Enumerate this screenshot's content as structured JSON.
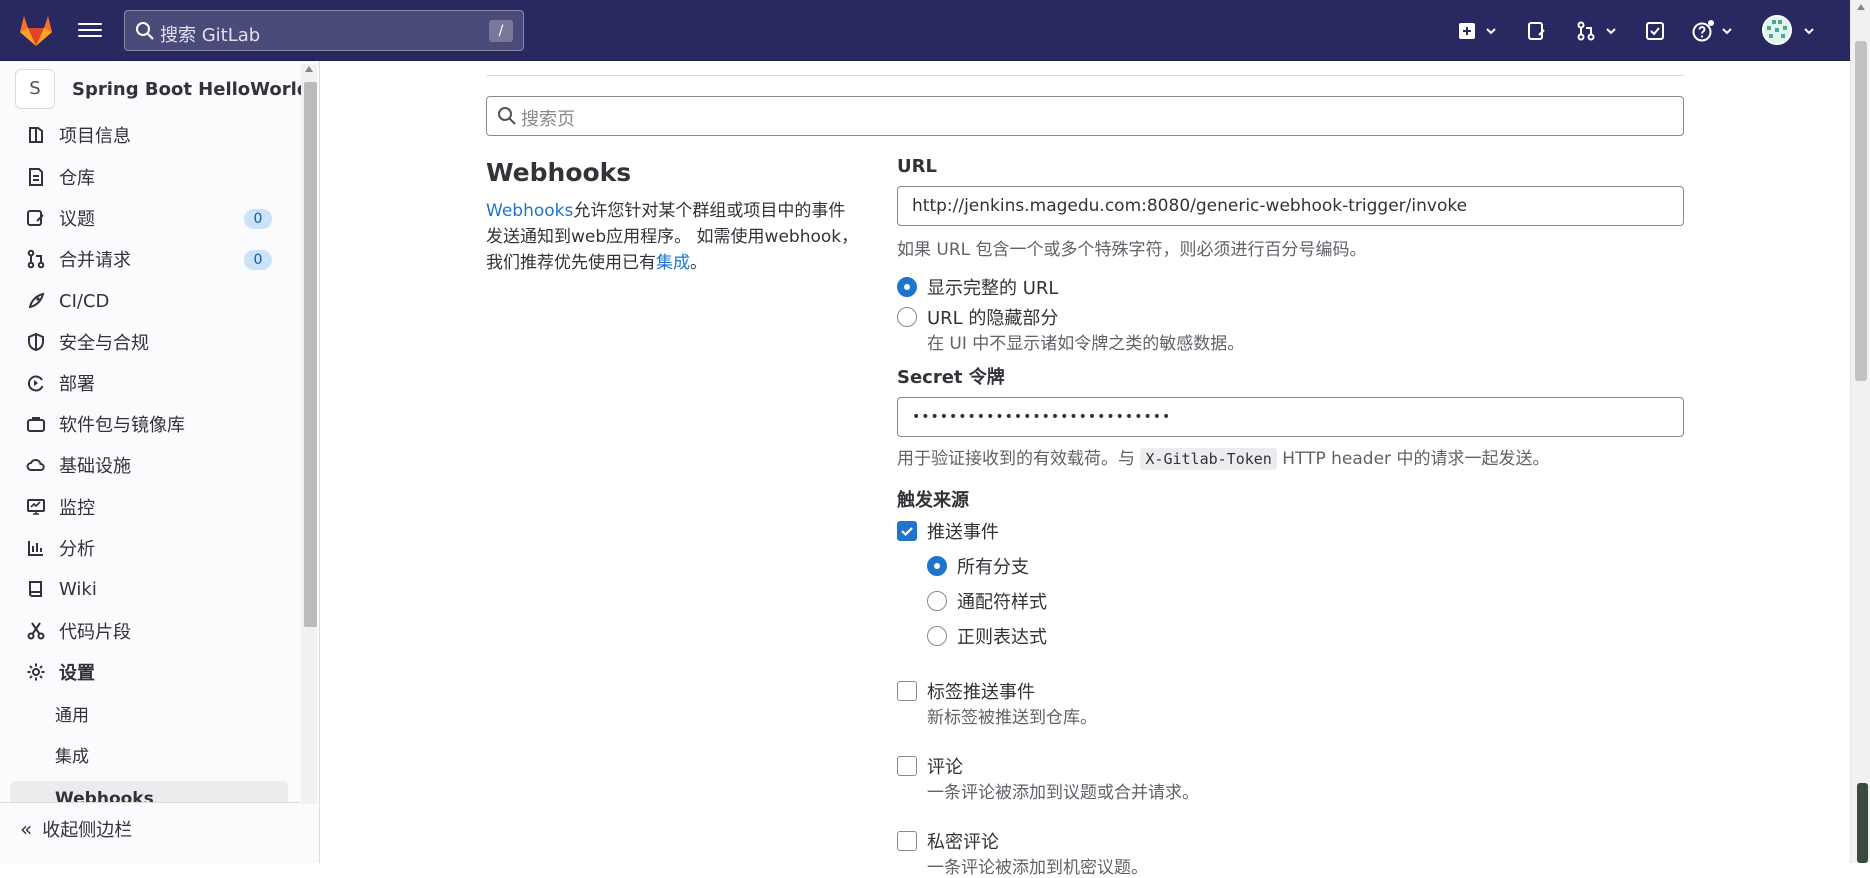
{
  "topbar": {
    "search_placeholder": "搜索 GitLab",
    "search_shortcut": "/",
    "icons": [
      "plus-square-icon",
      "issues-icon",
      "merge-request-icon",
      "todo-icon",
      "help-icon",
      "avatar"
    ]
  },
  "sidebar": {
    "project_initial": "S",
    "project_name": "Spring Boot HelloWorld",
    "items": [
      {
        "label": "项目信息",
        "icon": "project-info-icon"
      },
      {
        "label": "仓库",
        "icon": "repository-icon"
      },
      {
        "label": "议题",
        "icon": "issues-icon",
        "count": "0"
      },
      {
        "label": "合并请求",
        "icon": "merge-request-icon",
        "count": "0"
      },
      {
        "label": "CI/CD",
        "icon": "rocket-icon"
      },
      {
        "label": "安全与合规",
        "icon": "shield-icon"
      },
      {
        "label": "部署",
        "icon": "deploy-icon"
      },
      {
        "label": "软件包与镜像库",
        "icon": "package-icon"
      },
      {
        "label": "基础设施",
        "icon": "cloud-icon"
      },
      {
        "label": "监控",
        "icon": "monitor-icon"
      },
      {
        "label": "分析",
        "icon": "chart-icon"
      },
      {
        "label": "Wiki",
        "icon": "book-icon"
      },
      {
        "label": "代码片段",
        "icon": "snippet-icon"
      },
      {
        "label": "设置",
        "icon": "gear-icon"
      }
    ],
    "settings_sub": [
      {
        "label": "通用"
      },
      {
        "label": "集成"
      },
      {
        "label": "Webhooks"
      }
    ],
    "collapse_label": "收起侧边栏"
  },
  "main": {
    "search_placeholder": "搜索页",
    "section_title": "Webhooks",
    "description": {
      "link1": "Webhooks",
      "text1": "允许您针对某个群组或项目中的事件发送通知到web应用程序。 如需使用webhook，我们推荐优先使用已有",
      "link2": "集成",
      "text2": "。"
    },
    "form": {
      "url_label": "URL",
      "url_value": "http://jenkins.magedu.com:8080/generic-webhook-trigger/invoke",
      "url_help": "如果 URL 包含一个或多个特殊字符，则必须进行百分号编码。",
      "radio_full": "显示完整的 URL",
      "radio_masked": "URL 的隐藏部分",
      "radio_masked_help": "在 UI 中不显示诸如令牌之类的敏感数据。",
      "secret_label": "Secret 令牌",
      "secret_value": "••••••••••••••••••••••••••••",
      "secret_help_pre": "用于验证接收到的有效载荷。与",
      "secret_help_code": "X-Gitlab-Token",
      "secret_help_post": "HTTP header 中的请求一起发送。",
      "trigger_label": "触发来源",
      "push_events": "推送事件",
      "branch_all": "所有分支",
      "branch_wildcard": "通配符样式",
      "branch_regex": "正则表达式",
      "tag_push": "标签推送事件",
      "tag_push_help": "新标签被推送到仓库。",
      "comments": "评论",
      "comments_help": "一条评论被添加到议题或合并请求。",
      "private_comments": "私密评论",
      "private_comments_help": "一条评论被添加到机密议题。"
    }
  },
  "colors": {
    "topbar": "#292961",
    "accent": "#1f75cb",
    "sidebar_bg": "#fbfafd"
  }
}
